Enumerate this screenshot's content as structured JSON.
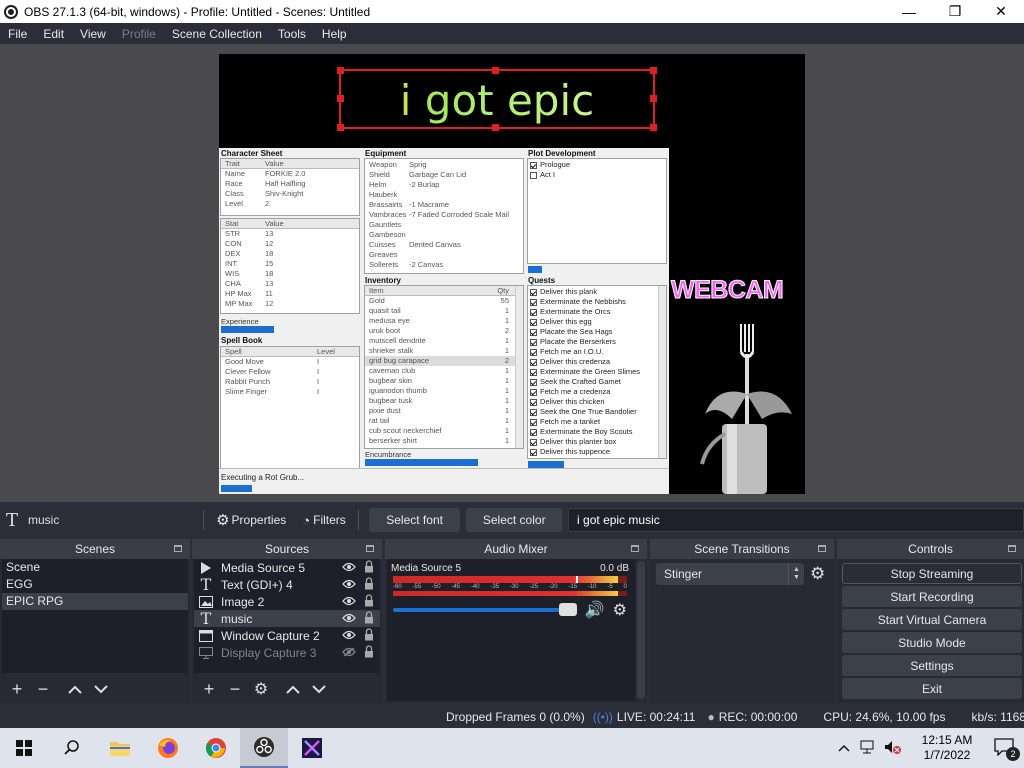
{
  "window": {
    "title": "OBS 27.1.3 (64-bit, windows) - Profile: Untitled - Scenes: Untitled",
    "minimize": "—",
    "maximize": "❐",
    "close": "✕"
  },
  "menu": [
    "File",
    "Edit",
    "View",
    "Profile",
    "Scene Collection",
    "Tools",
    "Help"
  ],
  "preview": {
    "text_source": "i got epic music",
    "webcam_label": "WEBCAM",
    "rpg": {
      "character_sheet": {
        "title": "Character Sheet",
        "headers": [
          "Trait",
          "Value"
        ],
        "rows": [
          [
            "Name",
            "FORKIE 2.0"
          ],
          [
            "Race",
            "Half Halfling"
          ],
          [
            "Class",
            "Shiv-Knight"
          ],
          [
            "Level",
            "2"
          ]
        ],
        "stat_headers": [
          "Stat",
          "Value"
        ],
        "stats": [
          [
            "STR",
            "13"
          ],
          [
            "CON",
            "12"
          ],
          [
            "DEX",
            "18"
          ],
          [
            "INT",
            "15"
          ],
          [
            "WIS",
            "18"
          ],
          [
            "CHA",
            "13"
          ],
          [
            "HP Max",
            "11"
          ],
          [
            "MP Max",
            "12"
          ]
        ],
        "experience_label": "Experience",
        "experience_progress": 0.38
      },
      "spell_book": {
        "title": "Spell Book",
        "headers": [
          "Spell",
          "Level"
        ],
        "rows": [
          [
            "Good Move",
            "I"
          ],
          [
            "Clever Fellow",
            "I"
          ],
          [
            "Rabbit Punch",
            "I"
          ],
          [
            "Slime Finger",
            "I"
          ]
        ]
      },
      "equipment": {
        "title": "Equipment",
        "rows": [
          [
            "Weapon",
            "Sprig"
          ],
          [
            "Shield",
            "Garbage Can Lid"
          ],
          [
            "Helm",
            "-2 Burlap"
          ],
          [
            "Hauberk",
            ""
          ],
          [
            "Brassairts",
            "-1 Macrame"
          ],
          [
            "Vambraces",
            "-7 Faded Corroded Scale Mail"
          ],
          [
            "Gauntlets",
            ""
          ],
          [
            "Gambeson",
            ""
          ],
          [
            "Cuisses",
            "Dented Canvas"
          ],
          [
            "Greaves",
            ""
          ],
          [
            "Sollerets",
            "-2 Canvas"
          ]
        ]
      },
      "inventory": {
        "title": "Inventory",
        "headers": [
          "Item",
          "Qty"
        ],
        "rows": [
          [
            "Gold",
            "55"
          ],
          [
            "quasit tail",
            "1"
          ],
          [
            "medusa eye",
            "1"
          ],
          [
            "uruk boot",
            "2"
          ],
          [
            "mutscell dendrite",
            "1"
          ],
          [
            "shrieker stalk",
            "1"
          ],
          [
            "grid bug carapace",
            "2"
          ],
          [
            "caveman club",
            "1"
          ],
          [
            "bugbear skin",
            "1"
          ],
          [
            "iguanodon thumb",
            "1"
          ],
          [
            "bugbear tusk",
            "1"
          ],
          [
            "pixie dust",
            "1"
          ],
          [
            "rat tail",
            "1"
          ],
          [
            "cub scout neckerchief",
            "1"
          ],
          [
            "berserker shirt",
            "1"
          ]
        ],
        "encumbrance_label": "Encumbrance",
        "encumbrance_progress": 0.72
      },
      "plot": {
        "title": "Plot Development",
        "rows": [
          {
            "label": "Prologue",
            "checked": true
          },
          {
            "label": "Act I",
            "checked": false
          }
        ],
        "progress": 0.1
      },
      "quests": {
        "title": "Quests",
        "rows": [
          "Deliver this plank",
          "Exterminate the Nebbishs",
          "Exterminate the Orcs",
          "Deliver this egg",
          "Placate the Sea Hags",
          "Placate the Berserkers",
          "Fetch me an I.O.U.",
          "Deliver this credenza",
          "Exterminate the Green Slimes",
          "Seek the Crafted Gamet",
          "Fetch me a credenza",
          "Deliver this chicken",
          "Seek the One True Bandolier",
          "Fetch me a tanket",
          "Exterminate the Boy Scouts",
          "Deliver this planter box",
          "Deliver this tuppence"
        ],
        "progress": 0.26
      },
      "status": "Executing a Rot Grub...",
      "status_progress": 0.07
    }
  },
  "context_bar": {
    "source_name": "music",
    "properties": "Properties",
    "filters": "Filters",
    "select_font": "Select font",
    "select_color": "Select color",
    "text_value": "i got epic music"
  },
  "scenes": {
    "title": "Scenes",
    "items": [
      "Scene",
      "EGG",
      "EPIC RPG"
    ],
    "selected_index": 2
  },
  "sources": {
    "title": "Sources",
    "items": [
      {
        "name": "Media Source 5",
        "icon": "play-icon"
      },
      {
        "name": "Text (GDI+) 4",
        "icon": "text-icon"
      },
      {
        "name": "Image 2",
        "icon": "image-icon"
      },
      {
        "name": "music",
        "icon": "text-icon"
      },
      {
        "name": "Window Capture 2",
        "icon": "window-icon"
      },
      {
        "name": "Display Capture 3",
        "icon": "monitor-icon"
      }
    ]
  },
  "audio_mixer": {
    "title": "Audio Mixer",
    "channel": "Media Source 5",
    "db": "0.0 dB",
    "ticks": [
      "-60",
      "-55",
      "-50",
      "-45",
      "-40",
      "-35",
      "-30",
      "-25",
      "-20",
      "-15",
      "-10",
      "-5",
      "0"
    ],
    "level": 0.96,
    "volume": 1.0
  },
  "transitions": {
    "title": "Scene Transitions",
    "selected": "Stinger"
  },
  "controls": {
    "title": "Controls",
    "buttons": [
      "Stop Streaming",
      "Start Recording",
      "Start Virtual Camera",
      "Studio Mode",
      "Settings",
      "Exit"
    ]
  },
  "status": {
    "dropped": "Dropped Frames 0 (0.0%)",
    "live": "LIVE: 00:24:11",
    "rec": "REC: 00:00:00",
    "cpu": "CPU: 24.6%, 10.00 fps",
    "kbps": "kb/s: 1168",
    "stream_health_color": "#00e600"
  },
  "taskbar": {
    "time": "12:15 AM",
    "date": "1/7/2022",
    "notifications": "2"
  }
}
